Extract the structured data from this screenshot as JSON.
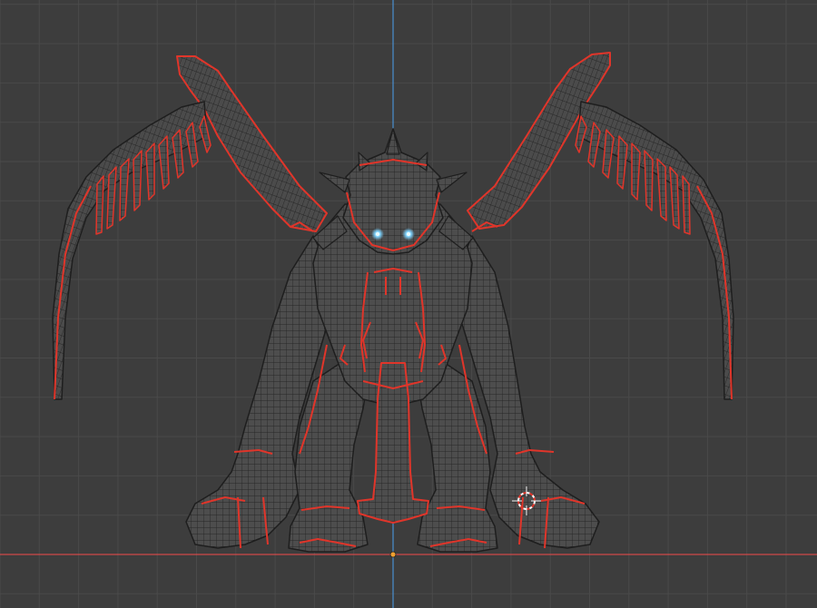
{
  "viewport": {
    "view": "front-orthographic",
    "background_color": "#3d3d3d",
    "grid_color": "#4a4a4a",
    "axis_colors": {
      "x_axis": "#d04a4a",
      "z_axis": "#4a8fd0"
    },
    "origin_color": "#f0a030",
    "selection_edge_color": "#e0352a",
    "wire_color": "#1a1a1a",
    "model_fill": "#505050",
    "eye_glow_color": "#7fd4ff"
  },
  "object": {
    "name": "",
    "icon": "dragon-mesh-icon"
  },
  "cursor_3d": {
    "icon": "3d-cursor-icon"
  }
}
